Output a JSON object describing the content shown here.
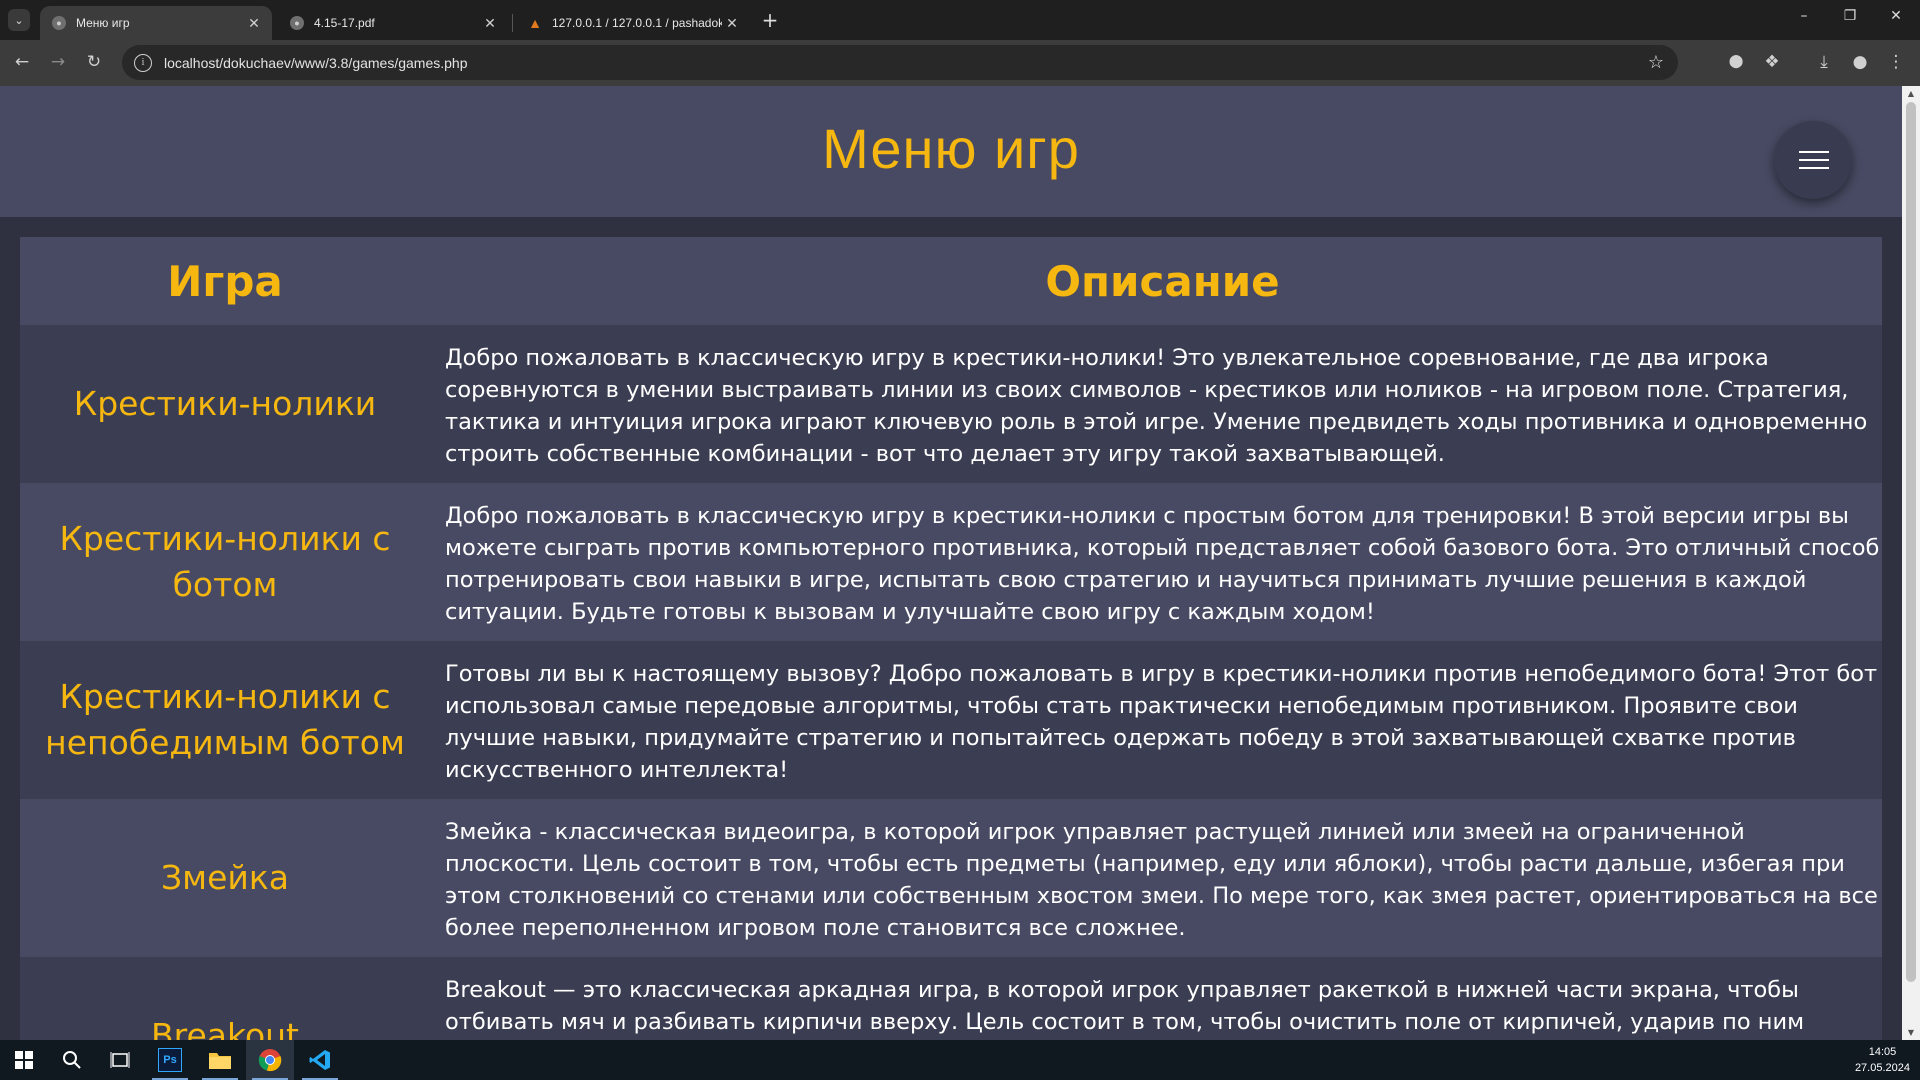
{
  "browser": {
    "tabs": [
      {
        "title": "Меню игр",
        "active": true
      },
      {
        "title": "4.15-17.pdf",
        "active": false
      },
      {
        "title": "127.0.0.1 / 127.0.0.1 / pashadok",
        "active": false
      }
    ],
    "new_tab_label": "+",
    "url": "localhost/dokuchaev/www/3.8/games/games.php"
  },
  "page": {
    "title": "Меню игр",
    "table": {
      "headers": {
        "game": "Игра",
        "description": "Описание"
      },
      "rows": [
        {
          "game": "Крестики-нолики",
          "description": "Добро пожаловать в классическую игру в крестики-нолики! Это увлекательное соревнование, где два игрока соревнуются в умении выстраивать линии из своих символов - крестиков или ноликов - на игровом поле. Стратегия, тактика и интуиция игрока играют ключевую роль в этой игре. Умение предвидеть ходы противника и одновременно строить собственные комбинации - вот что делает эту игру такой захватывающей."
        },
        {
          "game": "Крестики-нолики с ботом",
          "description": "Добро пожаловать в классическую игру в крестики-нолики с простым ботом для тренировки! В этой версии игры вы можете сыграть против компьютерного противника, который представляет собой базового бота. Это отличный способ потренировать свои навыки в игре, испытать свою стратегию и научиться принимать лучшие решения в каждой ситуации. Будьте готовы к вызовам и улучшайте свою игру с каждым ходом!"
        },
        {
          "game": "Крестики-нолики с непобедимым ботом",
          "description": "Готовы ли вы к настоящему вызову? Добро пожаловать в игру в крестики-нолики против непобедимого бота! Этот бот использовал самые передовые алгоритмы, чтобы стать практически непобедимым противником. Проявите свои лучшие навыки, придумайте стратегию и попытайтесь одержать победу в этой захватывающей схватке против искусственного интеллекта!"
        },
        {
          "game": "Змейка",
          "description": "Змейка - классическая видеоигра, в которой игрок управляет растущей линией или змеей на ограниченной плоскости. Цель состоит в том, чтобы есть предметы (например, еду или яблоки), чтобы расти дальше, избегая при этом столкновений со стенами или собственным хвостом змеи. По мере того, как змея растет, ориентироваться на все более переполненном игровом поле становится все сложнее."
        },
        {
          "game": "Breakout",
          "description": "Breakout — это классическая аркадная игра, в которой игрок управляет ракеткой в нижней части экрана, чтобы отбивать мяч и разбивать кирпичи вверху. Цель состоит в том, чтобы очистить поле от кирпичей, ударив по ним мячом, не позволяя мячу"
        }
      ]
    }
  },
  "taskbar": {
    "time": "14:05",
    "date": "27.05.2024",
    "ps_label": "Ps"
  },
  "colors": {
    "accent": "#f5b710",
    "header_bg": "#474a62",
    "row_dark": "#3b3d52",
    "page_bg": "#2f3040"
  }
}
